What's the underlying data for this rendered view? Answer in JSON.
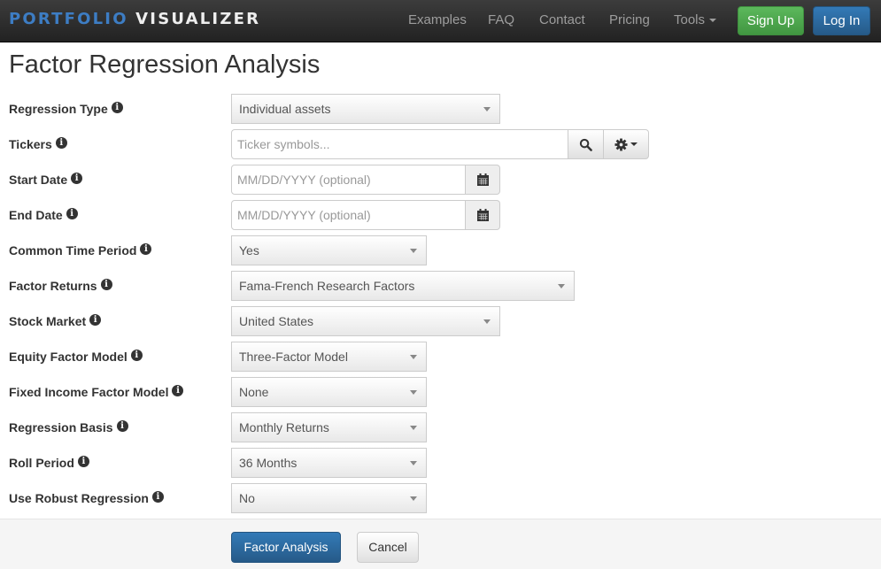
{
  "navbar": {
    "brand_part1": "PORTFOLIO",
    "brand_part2": "VISUALIZER",
    "links": [
      "Examples",
      "FAQ",
      "Contact",
      "Pricing",
      "Tools"
    ],
    "signup_label": "Sign Up",
    "login_label": "Log In",
    "colors": {
      "brand_blue": "#3d7dc4",
      "signup_green": "#5cb85c",
      "login_blue": "#337ab7"
    }
  },
  "page": {
    "title": "Factor Regression Analysis"
  },
  "form": {
    "regression_type": {
      "label": "Regression Type",
      "value": "Individual assets"
    },
    "tickers": {
      "label": "Tickers",
      "placeholder": "Ticker symbols..."
    },
    "start_date": {
      "label": "Start Date",
      "placeholder": "MM/DD/YYYY (optional)"
    },
    "end_date": {
      "label": "End Date",
      "placeholder": "MM/DD/YYYY (optional)"
    },
    "common_time_period": {
      "label": "Common Time Period",
      "value": "Yes"
    },
    "factor_returns": {
      "label": "Factor Returns",
      "value": "Fama-French Research Factors"
    },
    "stock_market": {
      "label": "Stock Market",
      "value": "United States"
    },
    "equity_factor_model": {
      "label": "Equity Factor Model",
      "value": "Three-Factor Model"
    },
    "fixed_income_factor_model": {
      "label": "Fixed Income Factor Model",
      "value": "None"
    },
    "regression_basis": {
      "label": "Regression Basis",
      "value": "Monthly Returns"
    },
    "roll_period": {
      "label": "Roll Period",
      "value": "36 Months"
    },
    "use_robust_regression": {
      "label": "Use Robust Regression",
      "value": "No"
    }
  },
  "actions": {
    "submit_label": "Factor Analysis",
    "cancel_label": "Cancel"
  },
  "icons": {
    "info": "i"
  }
}
